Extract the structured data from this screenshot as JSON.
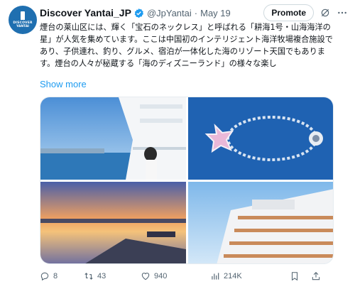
{
  "account": {
    "display_name": "Discover Yantai_JP",
    "handle": "@JpYantai",
    "separator": "·",
    "date": "May 19",
    "avatar_text_line1": "DISCOVER",
    "avatar_text_line2": "YANTAI"
  },
  "header": {
    "promote_label": "Promote",
    "grok_icon": "grok-icon",
    "more_icon": "more-icon"
  },
  "tweet": {
    "text": "煙台の莱山区には、輝く「宝石のネックレス」と呼ばれる「耕海1号・山海海洋の星」が人気を集めています。ここは中国初のインテリジェント海洋牧場複合施設であり、子供連れ、釣り、グルメ、宿泊が一体化した海のリゾート天国でもあります。煙台の人々が秘蔵する「海のディズニーランド」の様々な楽し",
    "show_more": "Show more"
  },
  "media": {
    "images": [
      "cruise-ship-deck-woman",
      "aerial-sea-necklace-structure",
      "sunset-pier-sea",
      "white-cruise-ship-decks"
    ]
  },
  "actions": {
    "replies": "8",
    "reposts": "43",
    "likes": "940",
    "views": "214K"
  },
  "colors": {
    "accent": "#1d9bf0",
    "muted": "#536471",
    "verified": "#1d9bf0"
  }
}
